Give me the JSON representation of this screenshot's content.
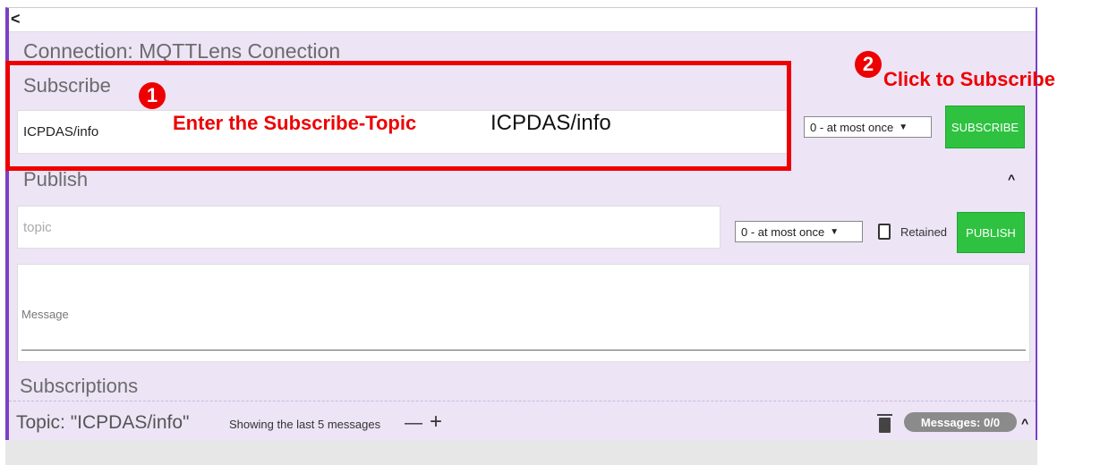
{
  "header": {
    "back_icon": "chevron-left-icon",
    "connection_title": "Connection: MQTTLens Conection"
  },
  "subscribe": {
    "label": "Subscribe",
    "topic_value": "ICPDAS/info",
    "qos_selected": "0 - at most once",
    "button_label": "SUBSCRIBE"
  },
  "publish": {
    "label": "Publish",
    "topic_placeholder": "topic",
    "qos_selected": "0 - at most once",
    "retained_label": "Retained",
    "button_label": "PUBLISH",
    "message_placeholder": "Message"
  },
  "subscriptions": {
    "label": "Subscriptions",
    "topic_title": "Topic: \"ICPDAS/info\"",
    "showing_text": "Showing the last 5 messages",
    "minus": "—",
    "plus": "+",
    "messages_badge": "Messages: 0/0"
  },
  "annotations": {
    "step1_number": "1",
    "step1_text_red": "Enter the Subscribe-Topic",
    "step1_text_black": "ICPDAS/info",
    "step2_number": "2",
    "step2_text": "Click to Subscribe"
  },
  "colors": {
    "accent": "#7b3fc4",
    "button_green": "#2ec240",
    "annotation_red": "#ee0000",
    "panel_bg": "#ede4f6"
  }
}
